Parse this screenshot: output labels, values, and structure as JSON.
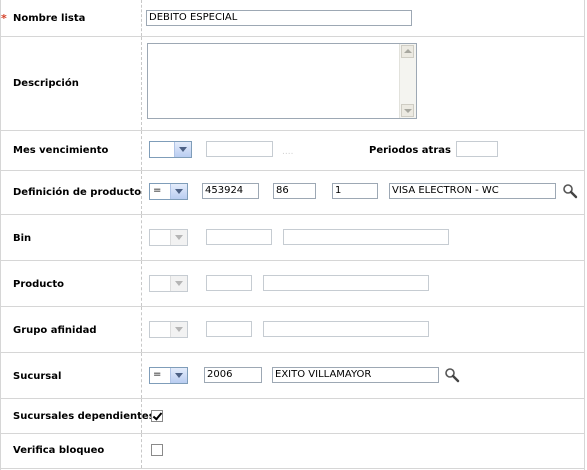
{
  "form": {
    "nombre_lista": {
      "label": "Nombre lista",
      "required_mark": "*",
      "value": "DEBITO ESPECIAL"
    },
    "descripcion": {
      "label": "Descripción",
      "value": ""
    },
    "mes_vencimiento": {
      "label": "Mes vencimiento",
      "select_value": "",
      "input_value": "",
      "ellipsis": "....",
      "periodos_label": "Periodos atras",
      "periodos_value": ""
    },
    "definicion_producto": {
      "label": "Definición de producto",
      "operator": "=",
      "field1": "453924",
      "field2": "86",
      "field3": "1",
      "description": "VISA ELECTRON - WC"
    },
    "bin": {
      "label": "Bin",
      "operator": "",
      "code": "",
      "description": ""
    },
    "producto": {
      "label": "Producto",
      "operator": "",
      "code": "",
      "description": ""
    },
    "grupo_afinidad": {
      "label": "Grupo afinidad",
      "operator": "",
      "code": "",
      "description": ""
    },
    "sucursal": {
      "label": "Sucursal",
      "operator": "=",
      "code": "2006",
      "description": "EXITO VILLAMAYOR"
    },
    "sucursales_dependientes": {
      "label": "Sucursales dependientes",
      "checked": true
    },
    "verifica_bloqueo": {
      "label": "Verifica bloqueo",
      "checked": false
    }
  }
}
